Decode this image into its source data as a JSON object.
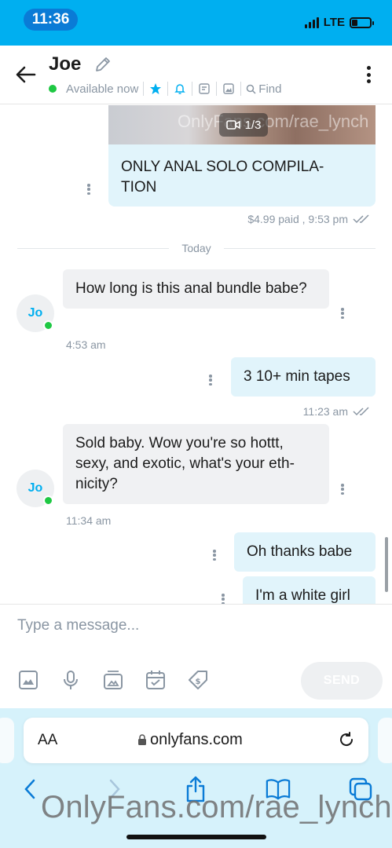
{
  "status_bar": {
    "time": "11:36",
    "network": "LTE",
    "battery_level": 0.3
  },
  "header": {
    "contact_name": "Joe",
    "presence": "Available now",
    "find_label": "Find"
  },
  "messages": {
    "media_card": {
      "counter": "1/3",
      "watermark": "OnlyFans.com/rae_lynch",
      "caption": "ONLY ANAL SOLO COMPILA-TION",
      "meta": "$4.99 paid , 9:53 pm"
    },
    "day_separator": "Today",
    "avatar_initials": "Jo",
    "items": [
      {
        "text": "How long is this anal bundle babe?",
        "time": "4:53 am"
      },
      {
        "text": "3 10+ min tapes",
        "time": "11:23 am"
      },
      {
        "text": "Sold baby. Wow you're so hottt, sexy, and exotic, what's your eth-nicity?",
        "time": "11:34 am"
      },
      {
        "text": "Oh thanks babe",
        "time": ""
      },
      {
        "text": "I'm a white girl",
        "time": ""
      }
    ]
  },
  "composer": {
    "placeholder": "Type a message...",
    "send_label": "SEND"
  },
  "browser": {
    "aa_label": "AA",
    "url": "onlyfans.com"
  },
  "watermark": "OnlyFans.com/rae_lynch",
  "colors": {
    "brand": "#00aff0",
    "incoming_bubble": "#f0f1f3",
    "outgoing_bubble": "#e1f4fb",
    "online": "#1ec843",
    "muted": "#8a96a3"
  }
}
